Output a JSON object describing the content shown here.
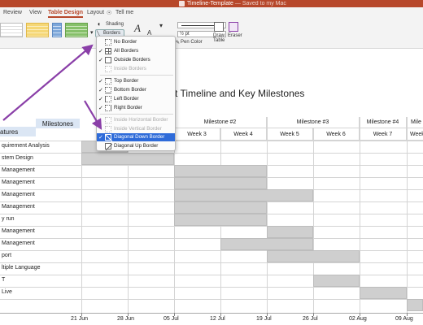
{
  "window": {
    "title": "Timeline-Template",
    "subtitle": " — Saved to my Mac ",
    "accent": "#b7472a"
  },
  "tabs": [
    {
      "label": "Review"
    },
    {
      "label": "View"
    },
    {
      "label": "Table Design",
      "active": true
    },
    {
      "label": "Layout"
    },
    {
      "label": "Tell me"
    }
  ],
  "ribbon": {
    "shading_label": "Shading",
    "borders_label": "Borders",
    "pen_weight_label": "½ pt",
    "pen_color_label": "Pen Color",
    "draw_table_label": "Draw Table",
    "eraser_label": "Eraser"
  },
  "borders_menu": {
    "items": [
      {
        "label": "No Border",
        "checked": false,
        "disabled": false
      },
      {
        "label": "All Borders",
        "checked": true,
        "disabled": false
      },
      {
        "label": "Outside Borders",
        "checked": true,
        "disabled": false
      },
      {
        "label": "Inside Borders",
        "checked": false,
        "disabled": true
      },
      {
        "label": "Top Border",
        "checked": true,
        "disabled": false
      },
      {
        "label": "Bottom Border",
        "checked": true,
        "disabled": false
      },
      {
        "label": "Left Border",
        "checked": true,
        "disabled": false
      },
      {
        "label": "Right Border",
        "checked": true,
        "disabled": false
      },
      {
        "label": "Inside Horizontal Border",
        "checked": false,
        "disabled": true
      },
      {
        "label": "Inside Vertical Border",
        "checked": false,
        "disabled": true
      },
      {
        "label": "Diagonal Down Border",
        "checked": true,
        "disabled": false,
        "selected": true
      },
      {
        "label": "Diagonal Up Border",
        "checked": false,
        "disabled": false
      }
    ]
  },
  "document": {
    "title": "t Timeline and Key Milestones",
    "milestones_label": "Milestones",
    "features_label": "atures",
    "milestone_headers": [
      "Milestone #2",
      "Milestone #3",
      "Milestone #4",
      "Mile"
    ],
    "week_headers": [
      "Week 3",
      "Week 4",
      "Week 5",
      "Week 6",
      "Week 7",
      "Week"
    ],
    "rows": [
      "quirement Analysis",
      "stem Design",
      "Management",
      "Management",
      "Management",
      "Management",
      "y run",
      "Management",
      "Management",
      "port",
      "ltiple Language",
      "T",
      "Live"
    ],
    "dates": [
      "21 Jun",
      "28 Jun",
      "05 Jul",
      "12 Jul",
      "19 Jul",
      "26 Jul",
      "02 Aug",
      "09 Aug"
    ]
  },
  "colors": {
    "bar_fill": "#cfcfcf",
    "header_fill": "#dbe6f4",
    "menu_highlight": "#2e6bd9",
    "arrow": "#8a3fa8"
  }
}
